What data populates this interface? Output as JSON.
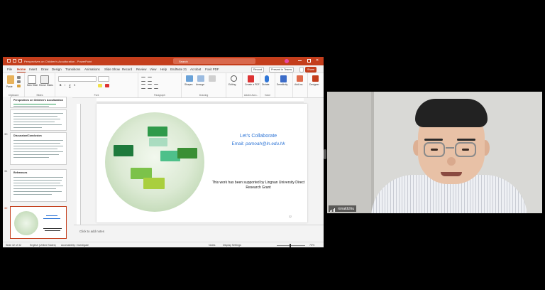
{
  "titlebar": {
    "filename": "Perspectives on Children's Acculturation - PowerPoint",
    "search_placeholder": "Search"
  },
  "menu": {
    "items": [
      "File",
      "Home",
      "Insert",
      "Draw",
      "Design",
      "Transitions",
      "Animations",
      "Slide Show",
      "Record",
      "Review",
      "View",
      "Help",
      "EndNote 21",
      "Acrobat",
      "Foxit PDF"
    ],
    "record_label": "Record",
    "present_label": "Present in Teams",
    "share_label": "Share"
  },
  "ribbon": {
    "paste": "Paste",
    "clipboard": "Clipboard",
    "new_slide": "New Slide",
    "reuse_slides": "Reuse Slides",
    "slides": "Slides",
    "font": "Font",
    "paragraph": "Paragraph",
    "shapes": "Shapes",
    "arrange": "Arrange",
    "drawing": "Drawing",
    "editing": "Editing",
    "create_pdf": "Create a PDF",
    "adobe_acrobat": "Adobe Acro...",
    "dictate": "Dictate",
    "voice": "Voice",
    "sensitivity": "Sensitivity",
    "add_ins": "Add-ins",
    "designer": "Designer"
  },
  "thumbnails": [
    {
      "num": "",
      "title": "Perspectives on Children's Acculturation"
    },
    {
      "num": "30",
      "title": "Discussion/Conclusion"
    },
    {
      "num": "31",
      "title": "References"
    },
    {
      "num": "32",
      "title": ""
    }
  ],
  "slide": {
    "collab": "Let's Collaborate",
    "email_label": "Email: ",
    "email": "pamoah@ln.edu.hk",
    "support": "This work has been supported by Lingnan University Direct Research Grant",
    "page_number": "32"
  },
  "notes_placeholder": "Click to add notes",
  "statusbar": {
    "slide_info": "Slide 32 of 32",
    "language": "English (United States)",
    "accessibility": "Accessibility: Investigate",
    "notes": "Notes",
    "display_settings": "Display Settings",
    "zoom": "70%"
  },
  "video": {
    "participant": "ronaldchiu"
  },
  "colors": {
    "accent": "#c43e1c",
    "link_blue": "#2e75d6",
    "bubble_green": "#1f7a3a"
  }
}
